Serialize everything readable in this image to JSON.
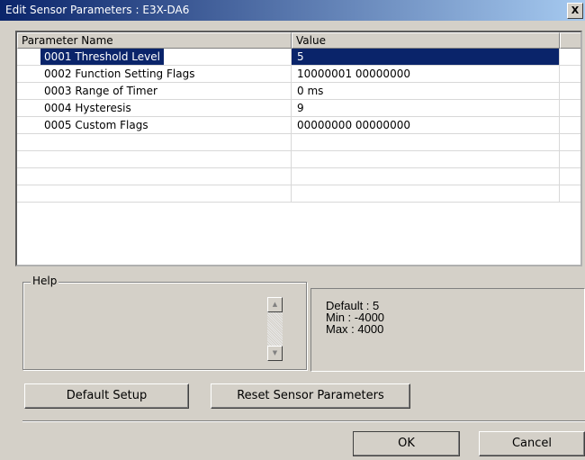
{
  "window": {
    "title": "Edit Sensor Parameters : E3X-DA6",
    "close_label": "X"
  },
  "grid": {
    "columns": [
      "Parameter Name",
      "Value"
    ],
    "rows": [
      {
        "name": "0001 Threshold Level",
        "value": "5",
        "selected": true
      },
      {
        "name": "0002 Function Setting Flags",
        "value": "10000001 00000000"
      },
      {
        "name": "0003 Range of Timer",
        "value": "0 ms"
      },
      {
        "name": "0004 Hysteresis",
        "value": "9"
      },
      {
        "name": "0005 Custom Flags",
        "value": "00000000 00000000"
      },
      {
        "name": "",
        "value": ""
      },
      {
        "name": "",
        "value": ""
      },
      {
        "name": "",
        "value": ""
      },
      {
        "name": "",
        "value": ""
      }
    ]
  },
  "help": {
    "label": "Help",
    "scroll_up_icon": "scroll-up-arrow",
    "scroll_down_icon": "scroll-down-arrow"
  },
  "info": {
    "default": "Default : 5",
    "min": "Min : -4000",
    "max": "Max : 4000"
  },
  "buttons": {
    "default_setup": "Default Setup",
    "reset_sensor": "Reset Sensor Parameters",
    "ok": "OK",
    "cancel": "Cancel"
  }
}
